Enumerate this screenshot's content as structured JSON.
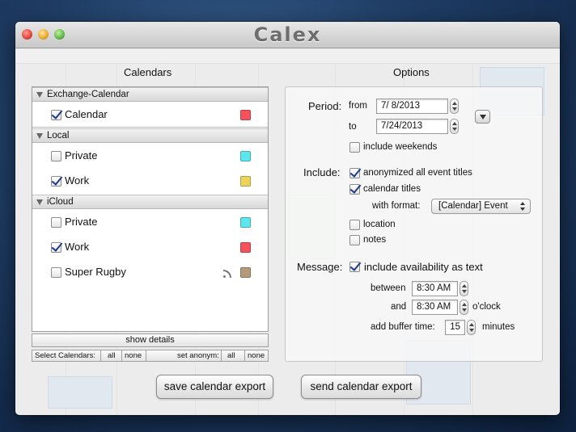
{
  "window": {
    "title": "Calex"
  },
  "calendars": {
    "heading": "Calendars",
    "groups": [
      {
        "name": "Exchange-Calendar",
        "items": [
          {
            "label": "Calendar",
            "checked": true,
            "color": "#f4535e"
          }
        ]
      },
      {
        "name": "Local",
        "items": [
          {
            "label": "Private",
            "checked": false,
            "color": "#5ee6ee"
          },
          {
            "label": "Work",
            "checked": true,
            "color": "#ecd35c"
          }
        ]
      },
      {
        "name": "iCloud",
        "items": [
          {
            "label": "Private",
            "checked": false,
            "color": "#5ee6ee"
          },
          {
            "label": "Work",
            "checked": true,
            "color": "#f4535e"
          },
          {
            "label": "Super Rugby",
            "checked": false,
            "color": "#b49a78",
            "icon": "rss-icon"
          }
        ]
      }
    ],
    "show_details": "show details",
    "select_calendars": "Select Calendars:",
    "all": "all",
    "none": "none",
    "set_anonym": "set anonym:"
  },
  "options": {
    "heading": "Options",
    "period_label": "Period:",
    "from_label": "from",
    "from_value": "7/  8/2013",
    "to_label": "to",
    "to_value": "7/24/2013",
    "include_weekends": {
      "label": "include weekends",
      "checked": false
    },
    "include_label": "Include:",
    "anonymized": {
      "label": "anonymized all event titles",
      "checked": true
    },
    "calendar_titles": {
      "label": "calendar titles",
      "checked": true
    },
    "with_format_label": "with format:",
    "format_value": "[Calendar] Event",
    "location": {
      "label": "location",
      "checked": false
    },
    "notes": {
      "label": "notes",
      "checked": false
    },
    "message_label": "Message:",
    "availability": {
      "label": "include availability as text",
      "checked": true
    },
    "between_label": "between",
    "between_value": "8:30 AM",
    "and_label": "and",
    "and_value": "8:30 AM",
    "oclock_label": "o'clock",
    "buffer_label": "add buffer time:",
    "buffer_value": "15",
    "minutes_label": "minutes"
  },
  "buttons": {
    "save": "save calendar export",
    "send": "send calendar export"
  }
}
